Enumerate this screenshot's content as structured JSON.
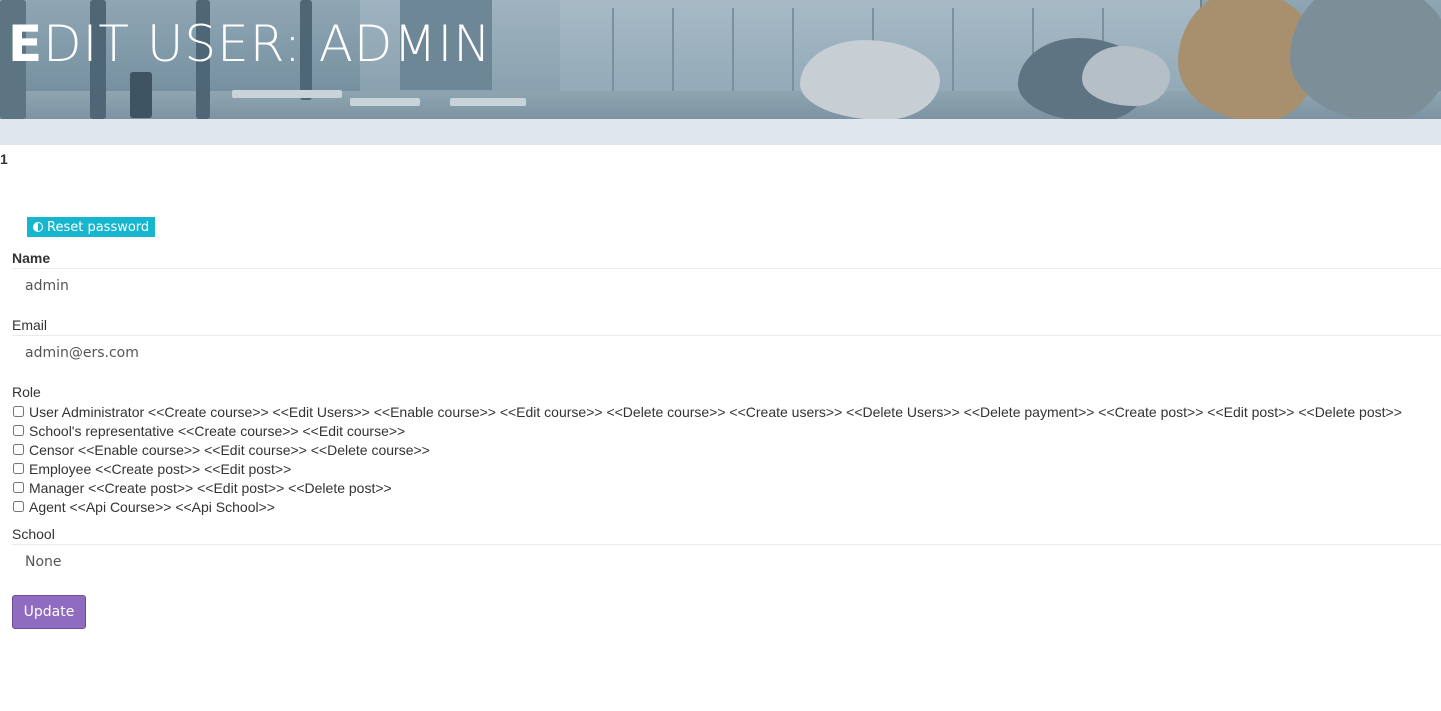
{
  "header": {
    "title_first": "E",
    "title_rest": "DIT USER: ADMIN"
  },
  "page": {
    "id_text": "1"
  },
  "actions": {
    "reset_password_label": "Reset password",
    "reset_password_icon": "half-circle-icon",
    "update_label": "Update"
  },
  "form": {
    "name_label": "Name",
    "name_value": "admin",
    "email_label": "Email",
    "email_value": "admin@ers.com",
    "role_label": "Role",
    "roles": [
      {
        "label": "User Administrator <<Create course>> <<Edit Users>> <<Enable course>> <<Edit course>> <<Delete course>> <<Create users>> <<Delete Users>> <<Delete payment>> <<Create post>> <<Edit post>> <<Delete post>>",
        "checked": false
      },
      {
        "label": "School's representative <<Create course>> <<Edit course>>",
        "checked": false
      },
      {
        "label": "Censor <<Enable course>> <<Edit course>> <<Delete course>>",
        "checked": false
      },
      {
        "label": "Employee <<Create post>> <<Edit post>>",
        "checked": false
      },
      {
        "label": "Manager <<Create post>> <<Edit post>> <<Delete post>>",
        "checked": false
      },
      {
        "label": "Agent <<Api Course>> <<Api School>>",
        "checked": false
      }
    ],
    "school_label": "School",
    "school_value": "None"
  },
  "colors": {
    "reset_button": "#17b6cf",
    "update_button": "#8f6cbf",
    "subbar": "#dfe6ee"
  }
}
